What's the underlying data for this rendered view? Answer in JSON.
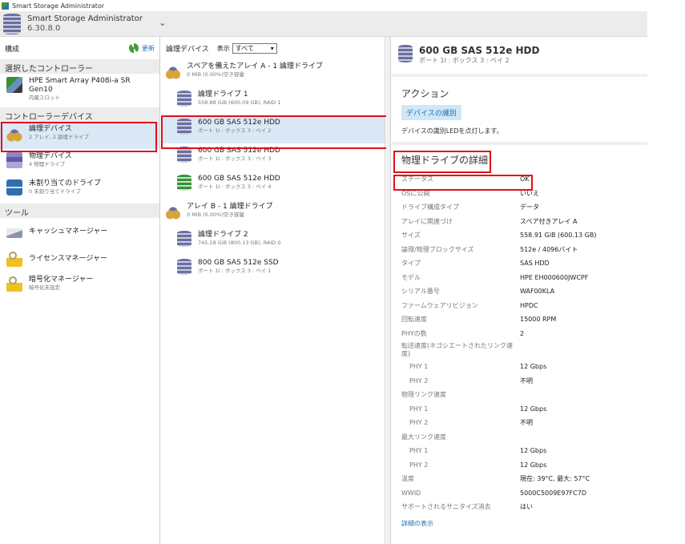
{
  "window": {
    "title": "Smart Storage Administrator"
  },
  "header": {
    "app_name": "Smart Storage Administrator",
    "version": "6.30.8.0"
  },
  "left": {
    "title": "構成",
    "refresh_label": "更新",
    "sections": {
      "selected_controller": "選択したコントローラー",
      "controller_devices": "コントローラーデバイス",
      "tools": "ツール"
    },
    "controller": {
      "name": "HPE Smart Array P408i-a SR Gen10",
      "sub": "内蔵スロット"
    },
    "devices": [
      {
        "name": "論理デバイス",
        "sub": "2 アレイ, 2 論理ドライブ"
      },
      {
        "name": "物理デバイス",
        "sub": "4 物理ドライブ"
      },
      {
        "name": "未割り当てのドライブ",
        "sub": "0 未割り当てドライブ"
      }
    ],
    "tools": [
      {
        "name": "キャッシュマネージャー",
        "sub": ""
      },
      {
        "name": "ライセンスマネージャー",
        "sub": ""
      },
      {
        "name": "暗号化マネージャー",
        "sub": "暗号化未設定"
      }
    ]
  },
  "middle": {
    "title": "論理デバイス",
    "filter_label": "表示",
    "filter_value": "すべて",
    "items": [
      {
        "name": "スペアを備えたアレイ A - 1 論理ドライブ",
        "sub": "0 MiB (0.00%)空き容量"
      },
      {
        "name": "論理ドライブ 1",
        "sub": "558.88 GiB (600.09 GB), RAID 1"
      },
      {
        "name": "600 GB SAS 512e HDD",
        "sub": "ポート 1I : ボックス 3 : ベイ 2"
      },
      {
        "name": "600 GB SAS 512e HDD",
        "sub": "ポート 1I : ボックス 3 : ベイ 3"
      },
      {
        "name": "600 GB SAS 512e HDD",
        "sub": "ポート 1I : ボックス 3 : ベイ 4"
      },
      {
        "name": "アレイ B - 1 論理ドライブ",
        "sub": "0 MiB (0.00%)空き容量"
      },
      {
        "name": "論理ドライブ 2",
        "sub": "745.18 GiB (800.13 GB), RAID 0"
      },
      {
        "name": "800 GB SAS 512e SSD",
        "sub": "ポート 1I : ボックス 3 : ベイ 1"
      }
    ]
  },
  "right": {
    "title": "600 GB SAS 512e HDD",
    "subtitle": "ポート 1I : ボックス 3 : ベイ 2",
    "actions_title": "アクション",
    "identify_button": "デバイスの識別",
    "identify_desc": "デバイスの識別LEDを点灯します。",
    "details_title": "物理ドライブの詳細",
    "properties": [
      {
        "k": "ステータス",
        "v": "OK"
      },
      {
        "k": "OSに公開",
        "v": "いいえ"
      },
      {
        "k": "ドライブ構成タイプ",
        "v": "データ"
      },
      {
        "k": "アレイに関連づけ",
        "v": "スペア付きアレイ A"
      },
      {
        "k": "サイズ",
        "v": "558.91 GiB (600.13 GB)"
      },
      {
        "k": "論理/物理ブロックサイズ",
        "v": "512e / 4096バイト"
      },
      {
        "k": "タイプ",
        "v": "SAS HDD"
      },
      {
        "k": "モデル",
        "v": "HPE EH000600JWCPF"
      },
      {
        "k": "シリアル番号",
        "v": "WAF00KLA"
      },
      {
        "k": "ファームウェアリビジョン",
        "v": "HPDC"
      },
      {
        "k": "回転速度",
        "v": "15000 RPM"
      },
      {
        "k": "PHYの数",
        "v": "2"
      },
      {
        "k": "転送速度(ネゴシエートされたリンク速度)",
        "v": ""
      },
      {
        "k": "PHY 1",
        "v": "12 Gbps",
        "sub": true
      },
      {
        "k": "PHY 2",
        "v": "不明",
        "sub": true
      },
      {
        "k": "物理リンク速度",
        "v": ""
      },
      {
        "k": "PHY 1",
        "v": "12 Gbps",
        "sub": true
      },
      {
        "k": "PHY 2",
        "v": "不明",
        "sub": true
      },
      {
        "k": "最大リンク速度",
        "v": ""
      },
      {
        "k": "PHY 1",
        "v": "12 Gbps",
        "sub": true
      },
      {
        "k": "PHY 2",
        "v": "12 Gbps",
        "sub": true
      },
      {
        "k": "温度",
        "v": "現在: 39°C, 最大: 57°C"
      },
      {
        "k": "WWID",
        "v": "5000C5009E97FC7D"
      },
      {
        "k": "サポートされるサニタイズ消去",
        "v": "はい"
      }
    ],
    "show_more": "詳細の表示"
  }
}
